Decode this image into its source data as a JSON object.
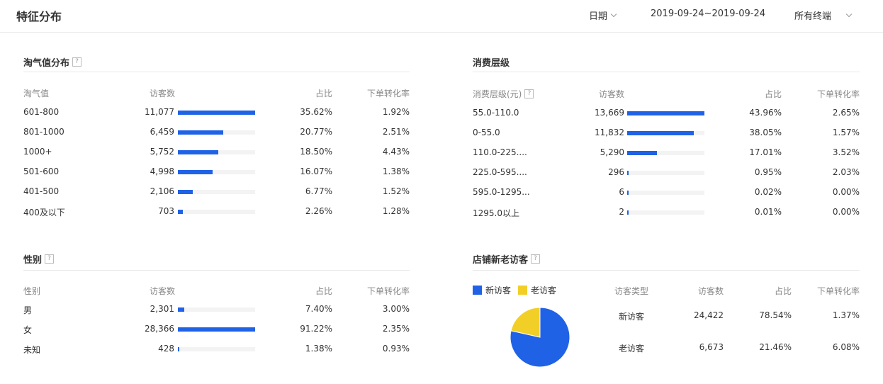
{
  "header": {
    "title": "特征分布",
    "date_label": "日期",
    "date_range": "2019-09-24~2019-09-24",
    "terminal": "所有终端"
  },
  "taoqi": {
    "title": "淘气值分布",
    "help_icon": "?",
    "columns": [
      "淘气值",
      "访客数",
      "占比",
      "下单转化率"
    ],
    "rows": [
      {
        "label": "601-800",
        "visitors": "11,077",
        "ratio": 35.62,
        "ratio_text": "35.62%",
        "conv": "1.92%"
      },
      {
        "label": "801-1000",
        "visitors": "6,459",
        "ratio": 20.77,
        "ratio_text": "20.77%",
        "conv": "2.51%"
      },
      {
        "label": "1000+",
        "visitors": "5,752",
        "ratio": 18.5,
        "ratio_text": "18.50%",
        "conv": "4.43%"
      },
      {
        "label": "501-600",
        "visitors": "4,998",
        "ratio": 16.07,
        "ratio_text": "16.07%",
        "conv": "1.38%"
      },
      {
        "label": "401-500",
        "visitors": "2,106",
        "ratio": 6.77,
        "ratio_text": "6.77%",
        "conv": "1.52%"
      },
      {
        "label": "400及以下",
        "visitors": "703",
        "ratio": 2.26,
        "ratio_text": "2.26%",
        "conv": "1.28%"
      }
    ]
  },
  "spend": {
    "title": "消费层级",
    "columns": [
      "消费层级(元)",
      "访客数",
      "占比",
      "下单转化率"
    ],
    "help_icon": "?",
    "rows": [
      {
        "label": "55.0-110.0",
        "visitors": "13,669",
        "ratio": 43.96,
        "ratio_text": "43.96%",
        "conv": "2.65%"
      },
      {
        "label": "0-55.0",
        "visitors": "11,832",
        "ratio": 38.05,
        "ratio_text": "38.05%",
        "conv": "1.57%"
      },
      {
        "label": "110.0-225....",
        "visitors": "5,290",
        "ratio": 17.01,
        "ratio_text": "17.01%",
        "conv": "3.52%"
      },
      {
        "label": "225.0-595....",
        "visitors": "296",
        "ratio": 0.95,
        "ratio_text": "0.95%",
        "conv": "2.03%"
      },
      {
        "label": "595.0-1295...",
        "visitors": "6",
        "ratio": 0.02,
        "ratio_text": "0.02%",
        "conv": "0.00%"
      },
      {
        "label": "1295.0以上",
        "visitors": "2",
        "ratio": 0.01,
        "ratio_text": "0.01%",
        "conv": "0.00%"
      }
    ]
  },
  "gender": {
    "title": "性别",
    "help_icon": "?",
    "columns": [
      "性别",
      "访客数",
      "占比",
      "下单转化率"
    ],
    "rows": [
      {
        "label": "男",
        "visitors": "2,301",
        "ratio": 7.4,
        "ratio_text": "7.40%",
        "conv": "3.00%"
      },
      {
        "label": "女",
        "visitors": "28,366",
        "ratio": 91.22,
        "ratio_text": "91.22%",
        "conv": "2.35%"
      },
      {
        "label": "未知",
        "visitors": "428",
        "ratio": 1.38,
        "ratio_text": "1.38%",
        "conv": "0.93%"
      }
    ]
  },
  "newold": {
    "title": "店铺新老访客",
    "help_icon": "?",
    "legend": [
      {
        "name": "新访客",
        "color": "#2062e6"
      },
      {
        "name": "老访客",
        "color": "#f2cf27"
      }
    ],
    "columns": [
      "访客类型",
      "访客数",
      "占比",
      "下单转化率"
    ],
    "rows": [
      {
        "label": "新访客",
        "visitors": "24,422",
        "ratio_text": "78.54%",
        "conv": "1.37%"
      },
      {
        "label": "老访客",
        "visitors": "6,673",
        "ratio_text": "21.46%",
        "conv": "6.08%"
      }
    ]
  },
  "colors": {
    "bar": "#2062e6",
    "track": "#f3f3f3",
    "new_visitor": "#2062e6",
    "old_visitor": "#f2cf27"
  },
  "chart_data": {
    "type": "pie",
    "categories": [
      "新访客",
      "老访客"
    ],
    "values": [
      78.54,
      21.46
    ],
    "colors": [
      "#2062e6",
      "#f2cf27"
    ]
  }
}
